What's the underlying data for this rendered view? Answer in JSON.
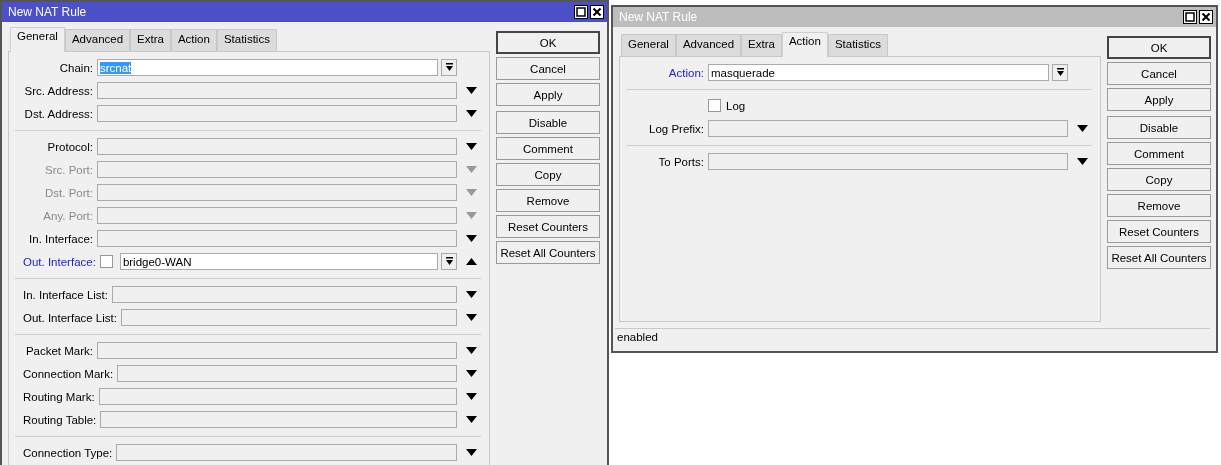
{
  "windows": [
    {
      "title": "New NAT Rule",
      "active": true,
      "tabs": [
        {
          "label": "General",
          "selected": true
        },
        {
          "label": "Advanced",
          "selected": false
        },
        {
          "label": "Extra",
          "selected": false
        },
        {
          "label": "Action",
          "selected": false
        },
        {
          "label": "Statistics",
          "selected": false
        }
      ],
      "groups": [
        [
          {
            "kind": "select",
            "label": "Chain:",
            "value": "srcnat",
            "value_selected": true,
            "highlighted": false,
            "disabled": false
          },
          {
            "kind": "optional",
            "label": "Src. Address:",
            "expanded": false,
            "highlighted": false,
            "disabled": false
          },
          {
            "kind": "optional",
            "label": "Dst. Address:",
            "expanded": false,
            "highlighted": false,
            "disabled": false
          }
        ],
        [
          {
            "kind": "optional",
            "label": "Protocol:",
            "expanded": false,
            "highlighted": false,
            "disabled": false
          },
          {
            "kind": "optional",
            "label": "Src. Port:",
            "expanded": false,
            "highlighted": false,
            "disabled": true
          },
          {
            "kind": "optional",
            "label": "Dst. Port:",
            "expanded": false,
            "highlighted": false,
            "disabled": true
          },
          {
            "kind": "optional",
            "label": "Any. Port:",
            "expanded": false,
            "highlighted": false,
            "disabled": true
          },
          {
            "kind": "optional",
            "label": "In. Interface:",
            "expanded": false,
            "highlighted": false,
            "disabled": false
          },
          {
            "kind": "optional",
            "label": "Out. Interface:",
            "expanded": true,
            "negated": false,
            "value": "bridge0-WAN",
            "highlighted": true,
            "disabled": false
          }
        ],
        [
          {
            "kind": "optional",
            "label": "In. Interface List:",
            "expanded": false,
            "highlighted": false,
            "disabled": false
          },
          {
            "kind": "optional",
            "label": "Out. Interface List:",
            "expanded": false,
            "highlighted": false,
            "disabled": false
          }
        ],
        [
          {
            "kind": "optional",
            "label": "Packet Mark:",
            "expanded": false,
            "highlighted": false,
            "disabled": false
          },
          {
            "kind": "optional",
            "label": "Connection Mark:",
            "expanded": false,
            "highlighted": false,
            "disabled": false
          },
          {
            "kind": "optional",
            "label": "Routing Mark:",
            "expanded": false,
            "highlighted": false,
            "disabled": false
          },
          {
            "kind": "optional",
            "label": "Routing Table:",
            "expanded": false,
            "highlighted": false,
            "disabled": false
          }
        ],
        [
          {
            "kind": "optional",
            "label": "Connection Type:",
            "expanded": false,
            "highlighted": false,
            "disabled": false
          }
        ]
      ],
      "button_groups": [
        [
          {
            "label": "OK",
            "default": true
          },
          {
            "label": "Cancel",
            "default": false
          },
          {
            "label": "Apply",
            "default": false
          }
        ],
        [
          {
            "label": "Disable",
            "default": false
          },
          {
            "label": "Comment",
            "default": false
          },
          {
            "label": "Copy",
            "default": false
          },
          {
            "label": "Remove",
            "default": false
          },
          {
            "label": "Reset Counters",
            "default": false
          },
          {
            "label": "Reset All Counters",
            "default": false
          }
        ]
      ]
    },
    {
      "title": "New NAT Rule",
      "active": false,
      "tabs": [
        {
          "label": "General",
          "selected": false
        },
        {
          "label": "Advanced",
          "selected": false
        },
        {
          "label": "Extra",
          "selected": false
        },
        {
          "label": "Action",
          "selected": true
        },
        {
          "label": "Statistics",
          "selected": false
        }
      ],
      "groups": [
        [
          {
            "kind": "select",
            "label": "Action:",
            "value": "masquerade",
            "value_selected": false,
            "highlighted": true,
            "disabled": false
          }
        ],
        [
          {
            "kind": "checkbox",
            "label": "Log",
            "checked": false,
            "highlighted": false,
            "disabled": false
          },
          {
            "kind": "optional",
            "label": "Log Prefix:",
            "expanded": false,
            "highlighted": false,
            "disabled": false
          }
        ],
        [
          {
            "kind": "optional",
            "label": "To Ports:",
            "expanded": false,
            "highlighted": false,
            "disabled": false
          }
        ]
      ],
      "button_groups": [
        [
          {
            "label": "OK",
            "default": true
          },
          {
            "label": "Cancel",
            "default": false
          },
          {
            "label": "Apply",
            "default": false
          }
        ],
        [
          {
            "label": "Disable",
            "default": false
          },
          {
            "label": "Comment",
            "default": false
          },
          {
            "label": "Copy",
            "default": false
          },
          {
            "label": "Remove",
            "default": false
          },
          {
            "label": "Reset Counters",
            "default": false
          },
          {
            "label": "Reset All Counters",
            "default": false
          }
        ]
      ],
      "status": "enabled"
    }
  ]
}
